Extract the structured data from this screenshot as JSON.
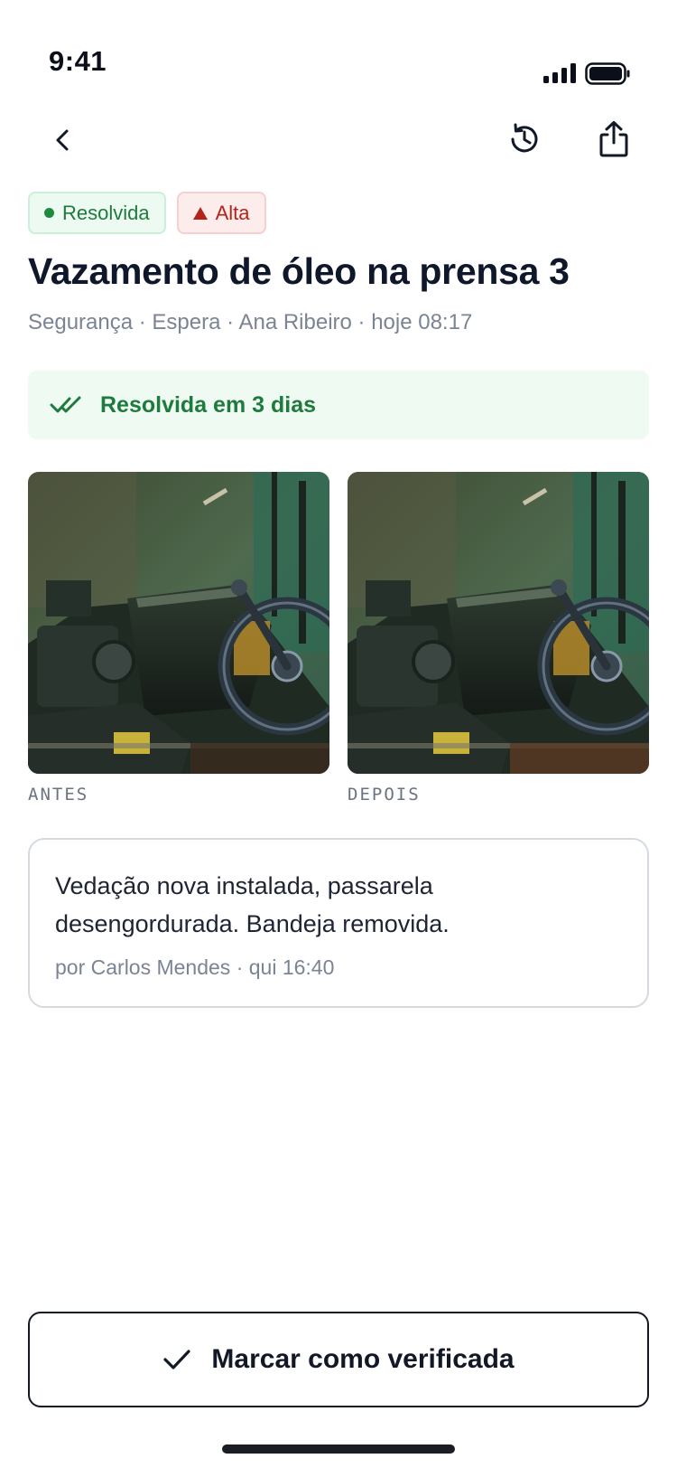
{
  "status_bar": {
    "time": "9:41"
  },
  "header": {
    "back_icon": "chevron-left-icon",
    "history_icon": "history-icon",
    "share_icon": "share-icon"
  },
  "badges": {
    "status": {
      "label": "Resolvida",
      "color": "#1f7a3d"
    },
    "priority": {
      "label": "Alta",
      "color": "#b42318"
    }
  },
  "incident": {
    "title": "Vazamento de óleo na prensa 3",
    "meta": "Segurança · Espera · Ana Ribeiro · hoje 08:17"
  },
  "resolution": {
    "label": "Resolvida em 3 dias",
    "icon": "double-check-icon"
  },
  "photos": {
    "before_label": "ANTES",
    "after_label": "DEPOIS"
  },
  "note": {
    "text": "Vedação nova instalada, passarela desengordurada. Bandeja removida.",
    "meta": "por Carlos Mendes · qui 16:40"
  },
  "action": {
    "label": "Marcar como verificada",
    "icon": "check-icon"
  }
}
